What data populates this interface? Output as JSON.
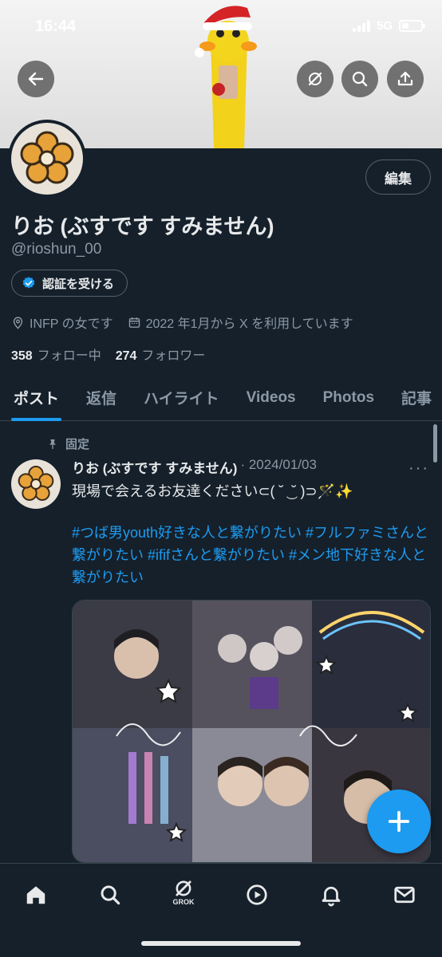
{
  "status_bar": {
    "time": "16:44",
    "network": "5G"
  },
  "header": {
    "back_icon": "arrow-left-icon",
    "grok_icon": "grok-icon",
    "search_icon": "search-icon",
    "share_icon": "share-icon"
  },
  "profile": {
    "edit_label": "編集",
    "display_name": "りお (ぶすです すみません)",
    "handle": "@rioshun_00",
    "verify_label": "認証を受ける",
    "location": "INFP の女です",
    "joined": "2022 年1月から X を利用しています",
    "following_count": "358",
    "following_label": "フォロー中",
    "followers_count": "274",
    "followers_label": "フォロワー"
  },
  "tabs": [
    {
      "label": "ポスト",
      "active": true
    },
    {
      "label": "返信"
    },
    {
      "label": "ハイライト"
    },
    {
      "label": "Videos"
    },
    {
      "label": "Photos"
    },
    {
      "label": "記事"
    }
  ],
  "post": {
    "pinned_label": "固定",
    "author": "りお (ぶすです すみません)",
    "date": "· 2024/01/03",
    "more": "···",
    "text": "現場で会えるお友達ください⊂( ˘ ͜ ˘ )⊃🪄✨",
    "hashtags": "#つば男youth好きな人と繋がりたい  #フルファミさんと繋がりたい  #ififさんと繋がりたい #メン地下好きな人と繋がりたい"
  },
  "bottom_nav": {
    "grok_label": "GROK"
  },
  "colors": {
    "accent": "#1d9bf0",
    "background": "#15202b",
    "secondary_text": "#8b98a5"
  }
}
